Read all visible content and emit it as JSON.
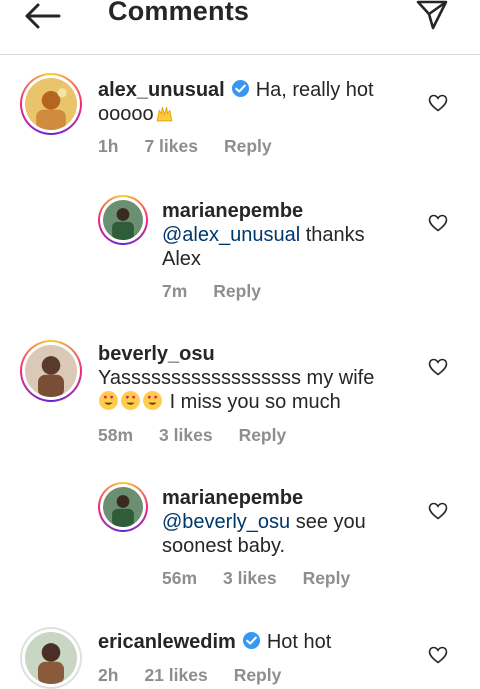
{
  "header": {
    "title": "Comments"
  },
  "comments": [
    {
      "username": "alex_unusual",
      "text_before": "Ha, really hot",
      "text_line2": "ooooo",
      "time": "1h",
      "likes": "7 likes",
      "reply": "Reply"
    },
    {
      "username": "marianepembe",
      "mention": "@alex_unusual",
      "text_after": " thanks",
      "text_line2": "Alex",
      "time": "7m",
      "reply": "Reply"
    },
    {
      "username": "beverly_osu",
      "text_line1": "Yassssssssssssssssss my wife",
      "text_line2": "I miss you so much",
      "time": "58m",
      "likes": "3 likes",
      "reply": "Reply"
    },
    {
      "username": "marianepembe",
      "mention": "@beverly_osu",
      "text_after": " see you",
      "text_line2": "soonest baby.",
      "time": "56m",
      "likes": "3 likes",
      "reply": "Reply"
    },
    {
      "username": "ericanlewedim",
      "text_before": "Hot hot",
      "time": "2h",
      "likes": "21 likes",
      "reply": "Reply"
    }
  ],
  "icons": {
    "back": "arrow-left-icon",
    "send": "paper-plane-icon",
    "verified": "verified-badge-icon",
    "like": "heart-outline-icon",
    "raising_hands": "raising-hands-emoji",
    "heart_eyes": "heart-eyes-emoji"
  },
  "colors": {
    "accent_verified": "#3897f0",
    "meta_grey": "#8e8e8e",
    "mention_blue": "#00376b"
  }
}
